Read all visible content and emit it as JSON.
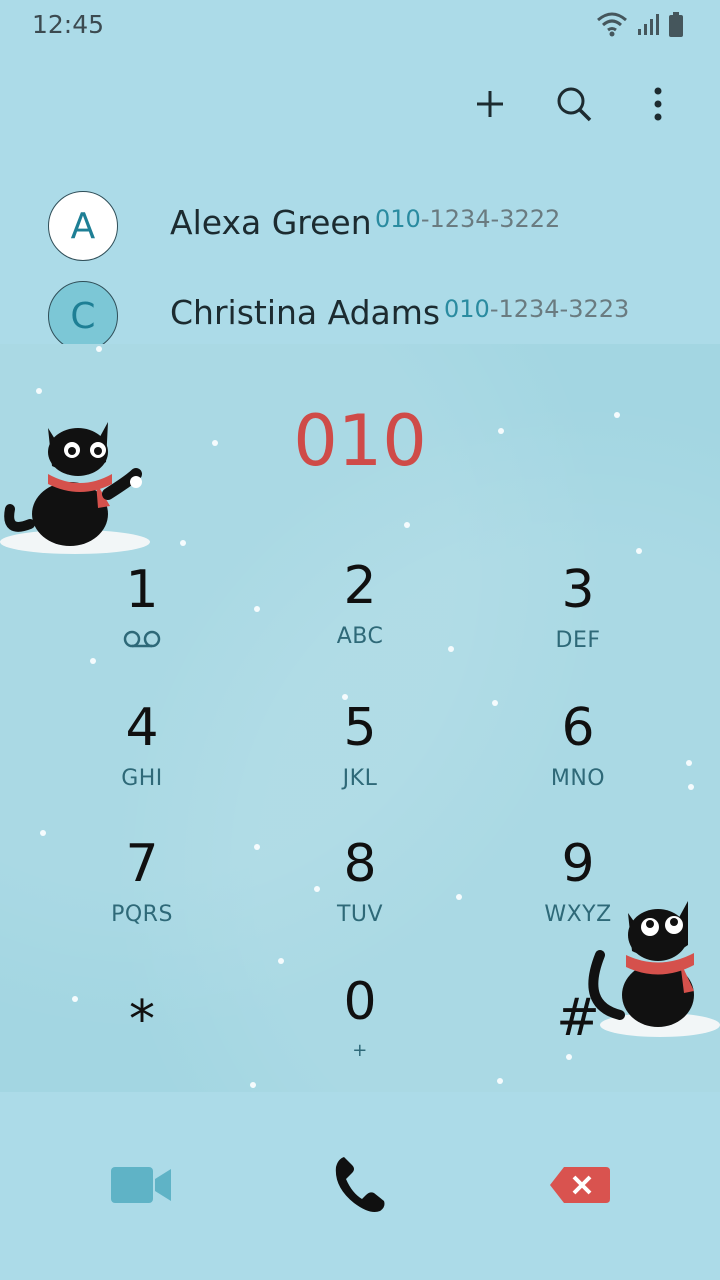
{
  "status": {
    "time": "12:45"
  },
  "toolbar": {
    "add_icon": "plus-icon",
    "search_icon": "search-icon",
    "more_icon": "more-vert-icon"
  },
  "contacts": [
    {
      "initial": "A",
      "name": "Alexa Green",
      "number_match": "010",
      "number_rest": "-1234-3222"
    },
    {
      "initial": "C",
      "name": "Christina Adams",
      "number_match": "010",
      "number_rest": "-1234-3223"
    }
  ],
  "dialer": {
    "digits": "010"
  },
  "keypad": [
    {
      "digit": "1",
      "letters": ""
    },
    {
      "digit": "2",
      "letters": "ABC"
    },
    {
      "digit": "3",
      "letters": "DEF"
    },
    {
      "digit": "4",
      "letters": "GHI"
    },
    {
      "digit": "5",
      "letters": "JKL"
    },
    {
      "digit": "6",
      "letters": "MNO"
    },
    {
      "digit": "7",
      "letters": "PQRS"
    },
    {
      "digit": "8",
      "letters": "TUV"
    },
    {
      "digit": "9",
      "letters": "WXYZ"
    },
    {
      "digit": "*",
      "letters": ""
    },
    {
      "digit": "0",
      "letters": "+"
    },
    {
      "digit": "#",
      "letters": ""
    }
  ],
  "colors": {
    "background": "#acdbe8",
    "digits": "#cf4b48",
    "video_call": "#5fb3c6",
    "backspace": "#d9534f"
  }
}
